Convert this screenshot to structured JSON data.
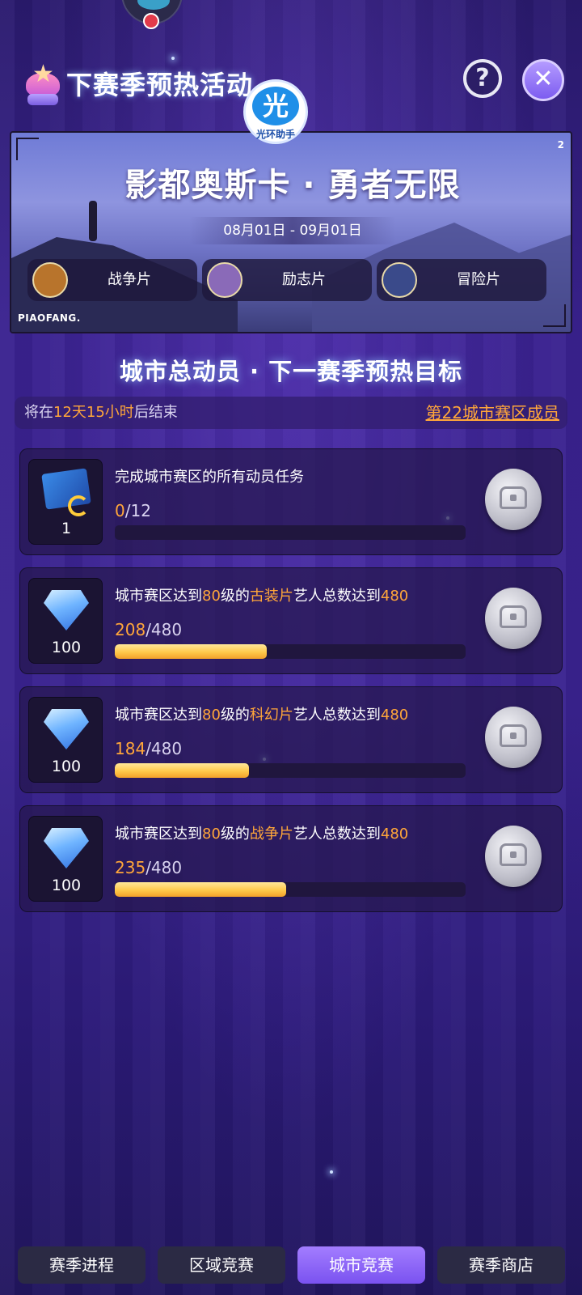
{
  "header": {
    "title": "下赛季预热活动",
    "help_label": "?",
    "close_label": "✕",
    "badge_main": "光",
    "badge_caption": "光环助手"
  },
  "banner": {
    "title": "影都奥斯卡 · 勇者无限",
    "date_range": "08月01日 - 09月01日",
    "corner_number": "2",
    "brand": "PIAOFANG.",
    "genres": [
      {
        "label": "战争片",
        "icon": "soldier-icon",
        "color": "#b8742c"
      },
      {
        "label": "励志片",
        "icon": "climber-icon",
        "color": "#8a6ab8"
      },
      {
        "label": "冒险片",
        "icon": "ship-icon",
        "color": "#3a4a8a"
      }
    ]
  },
  "section": {
    "title": "城市总动员 · 下一赛季预热目标",
    "timer_prefix": "将在",
    "timer_value": "12天15小时",
    "timer_suffix": "后结束",
    "rank_link": "第22城市赛区成员"
  },
  "tasks": [
    {
      "reward_icon": "ticket-icon",
      "reward_qty": "1",
      "desc_parts": [
        "完成城市赛区的所有动员任务"
      ],
      "current": "0",
      "total": "/12",
      "progress": 0.0
    },
    {
      "reward_icon": "diamond-icon",
      "reward_qty": "100",
      "desc_parts": [
        "城市赛区达到",
        "80",
        "级的",
        "古装片",
        "艺人总数达到",
        "480"
      ],
      "current": "208",
      "total": "/480",
      "progress": 0.4333
    },
    {
      "reward_icon": "diamond-icon",
      "reward_qty": "100",
      "desc_parts": [
        "城市赛区达到",
        "80",
        "级的",
        "科幻片",
        "艺人总数达到",
        "480"
      ],
      "current": "184",
      "total": "/480",
      "progress": 0.3833
    },
    {
      "reward_icon": "diamond-icon",
      "reward_qty": "100",
      "desc_parts": [
        "城市赛区达到",
        "80",
        "级的",
        "战争片",
        "艺人总数达到",
        "480"
      ],
      "current": "235",
      "total": "/480",
      "progress": 0.4896
    }
  ],
  "tabs": [
    {
      "label": "赛季进程",
      "active": false
    },
    {
      "label": "区域竞赛",
      "active": false
    },
    {
      "label": "城市竞赛",
      "active": true
    },
    {
      "label": "赛季商店",
      "active": false
    }
  ],
  "colors": {
    "accent_orange": "#ffa63a",
    "active_tab": "#8a63f6",
    "progress_fill": "#ffc94a"
  }
}
